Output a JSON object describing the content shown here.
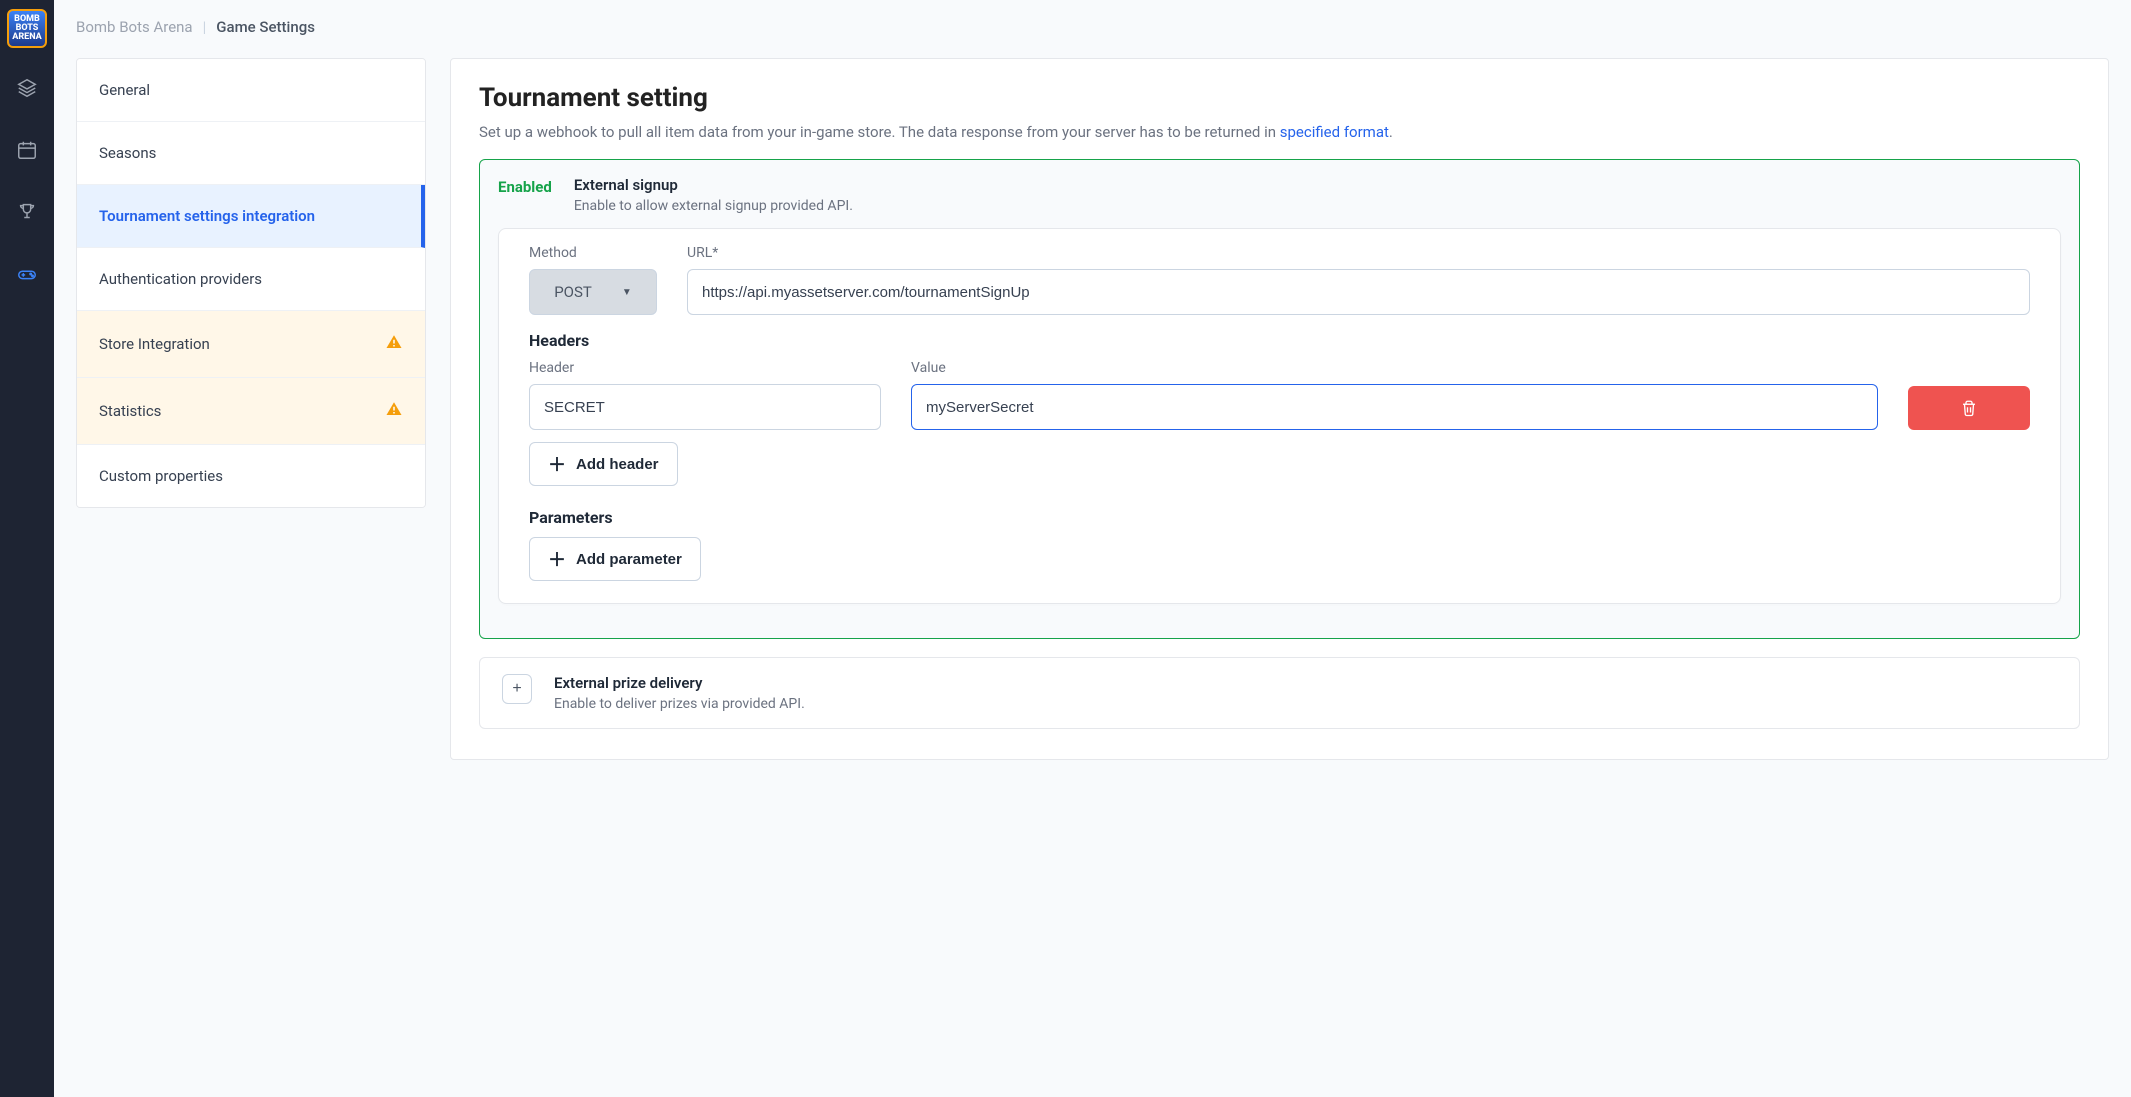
{
  "breadcrumb": {
    "project": "Bomb Bots Arena",
    "page": "Game Settings"
  },
  "logo_text": "BOMB BOTS ARENA",
  "sidebar": {
    "items": [
      {
        "label": "General",
        "state": "normal"
      },
      {
        "label": "Seasons",
        "state": "normal"
      },
      {
        "label": "Tournament settings integration",
        "state": "active"
      },
      {
        "label": "Authentication providers",
        "state": "normal"
      },
      {
        "label": "Store Integration",
        "state": "warn"
      },
      {
        "label": "Statistics",
        "state": "warn"
      },
      {
        "label": "Custom properties",
        "state": "normal"
      }
    ]
  },
  "panel": {
    "title": "Tournament setting",
    "subtitle_pre": "Set up a webhook to pull all item data from your in-game store. The data response from your server has to be returned in ",
    "subtitle_link": "specified format",
    "subtitle_post": "."
  },
  "signup": {
    "status": "Enabled",
    "title": "External signup",
    "desc": "Enable to allow external signup provided API.",
    "method_label": "Method",
    "method_value": "POST",
    "url_label": "URL*",
    "url_value": "https://api.myassetserver.com/tournamentSignUp",
    "headers_title": "Headers",
    "header_label": "Header",
    "value_label": "Value",
    "header_key": "SECRET",
    "header_value": "myServerSecret",
    "add_header": "Add header",
    "params_title": "Parameters",
    "add_param": "Add parameter"
  },
  "prize": {
    "title": "External prize delivery",
    "desc": "Enable to deliver prizes via provided API.",
    "expand": "+"
  }
}
